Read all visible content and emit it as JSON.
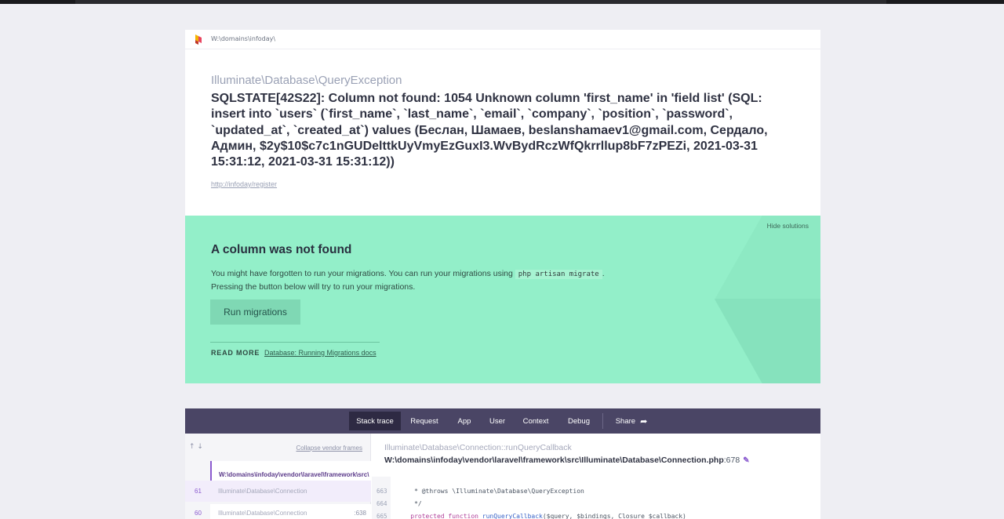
{
  "header": {
    "path": "W:\\domains\\infoday\\",
    "exception_class": "Illuminate\\Database\\QueryException",
    "message": "SQLSTATE[42S22]: Column not found: 1054 Unknown column 'first_name' in 'field list' (SQL: insert into `users` (`first_name`, `last_name`, `email`, `company`, `position`, `password`, `updated_at`, `created_at`) values (Беслан, Шамаев, beslanshamaev1@gmail.com, Сердало, Админ, $2y$10$c7c1nGUDelttkUyVmyEzGuxI3.WvBydRczWfQkrrllup8bF7zPEZi, 2021-03-31 15:31:12, 2021-03-31 15:31:12))",
    "url": "http://infoday/register"
  },
  "solution": {
    "hide_label": "Hide solutions",
    "title": "A column was not found",
    "text_before": "You might have forgotten to run your migrations. You can run your migrations using ",
    "code": "php artisan migrate",
    "text_after": ".",
    "text_line2": "Pressing the button below will try to run your migrations.",
    "button": "Run migrations",
    "read_more": "READ MORE",
    "doc_link": "Database: Running Migrations docs"
  },
  "tabs": {
    "items": [
      "Stack trace",
      "Request",
      "App",
      "User",
      "Context",
      "Debug"
    ],
    "share": "Share",
    "active": "Stack trace"
  },
  "stack": {
    "arrows": "↑ ↓",
    "collapse": "Collapse vendor frames",
    "selected_path": "W:\\domains\\infoday\\vendor\\laravel\\framework\\src\\",
    "frames": [
      {
        "num": "61",
        "cls": "Illuminate\\Database\\Connection",
        "line": ""
      },
      {
        "num": "60",
        "cls": "Illuminate\\Database\\Connection",
        "line": ":638"
      }
    ],
    "code_class": "Illuminate\\Database\\Connection::runQueryCallback",
    "code_file": "W:\\domains\\infoday\\vendor\\laravel\\framework\\src\\Illuminate\\Database\\Connection.php",
    "code_line": ":678",
    "code_lines": [
      {
        "n": "663",
        "text": "     * @throws \\Illuminate\\Database\\QueryException"
      },
      {
        "n": "664",
        "text": "     */"
      },
      {
        "n": "665",
        "kw": "    protected function ",
        "fn": "runQueryCallback",
        "rest": "($query, $bindings, Closure $callback)"
      }
    ]
  }
}
